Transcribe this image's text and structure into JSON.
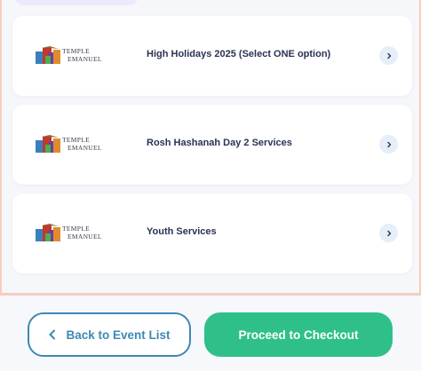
{
  "events": [
    {
      "logo_line1": "TEMPLE",
      "logo_line2": "EMANUEL",
      "title": "High Holidays 2025 (Select ONE option)",
      "icon": "chevron-right-icon"
    },
    {
      "logo_line1": "TEMPLE",
      "logo_line2": "EMANUEL",
      "title": "Rosh Hashanah Day 2 Services",
      "icon": "chevron-right-icon"
    },
    {
      "logo_line1": "TEMPLE",
      "logo_line2": "EMANUEL",
      "title": "Youth Services",
      "icon": "chevron-right-icon"
    }
  ],
  "footer": {
    "back_label": "Back to Event List",
    "back_icon": "chevron-left-icon",
    "checkout_label": "Proceed to Checkout"
  },
  "colors": {
    "back_button": "#3f88b4",
    "checkout_button": "#2fc08a",
    "title_text": "#2a3354",
    "chevron_bg": "#e6eef8",
    "frame_border": "#f6cdbf"
  }
}
